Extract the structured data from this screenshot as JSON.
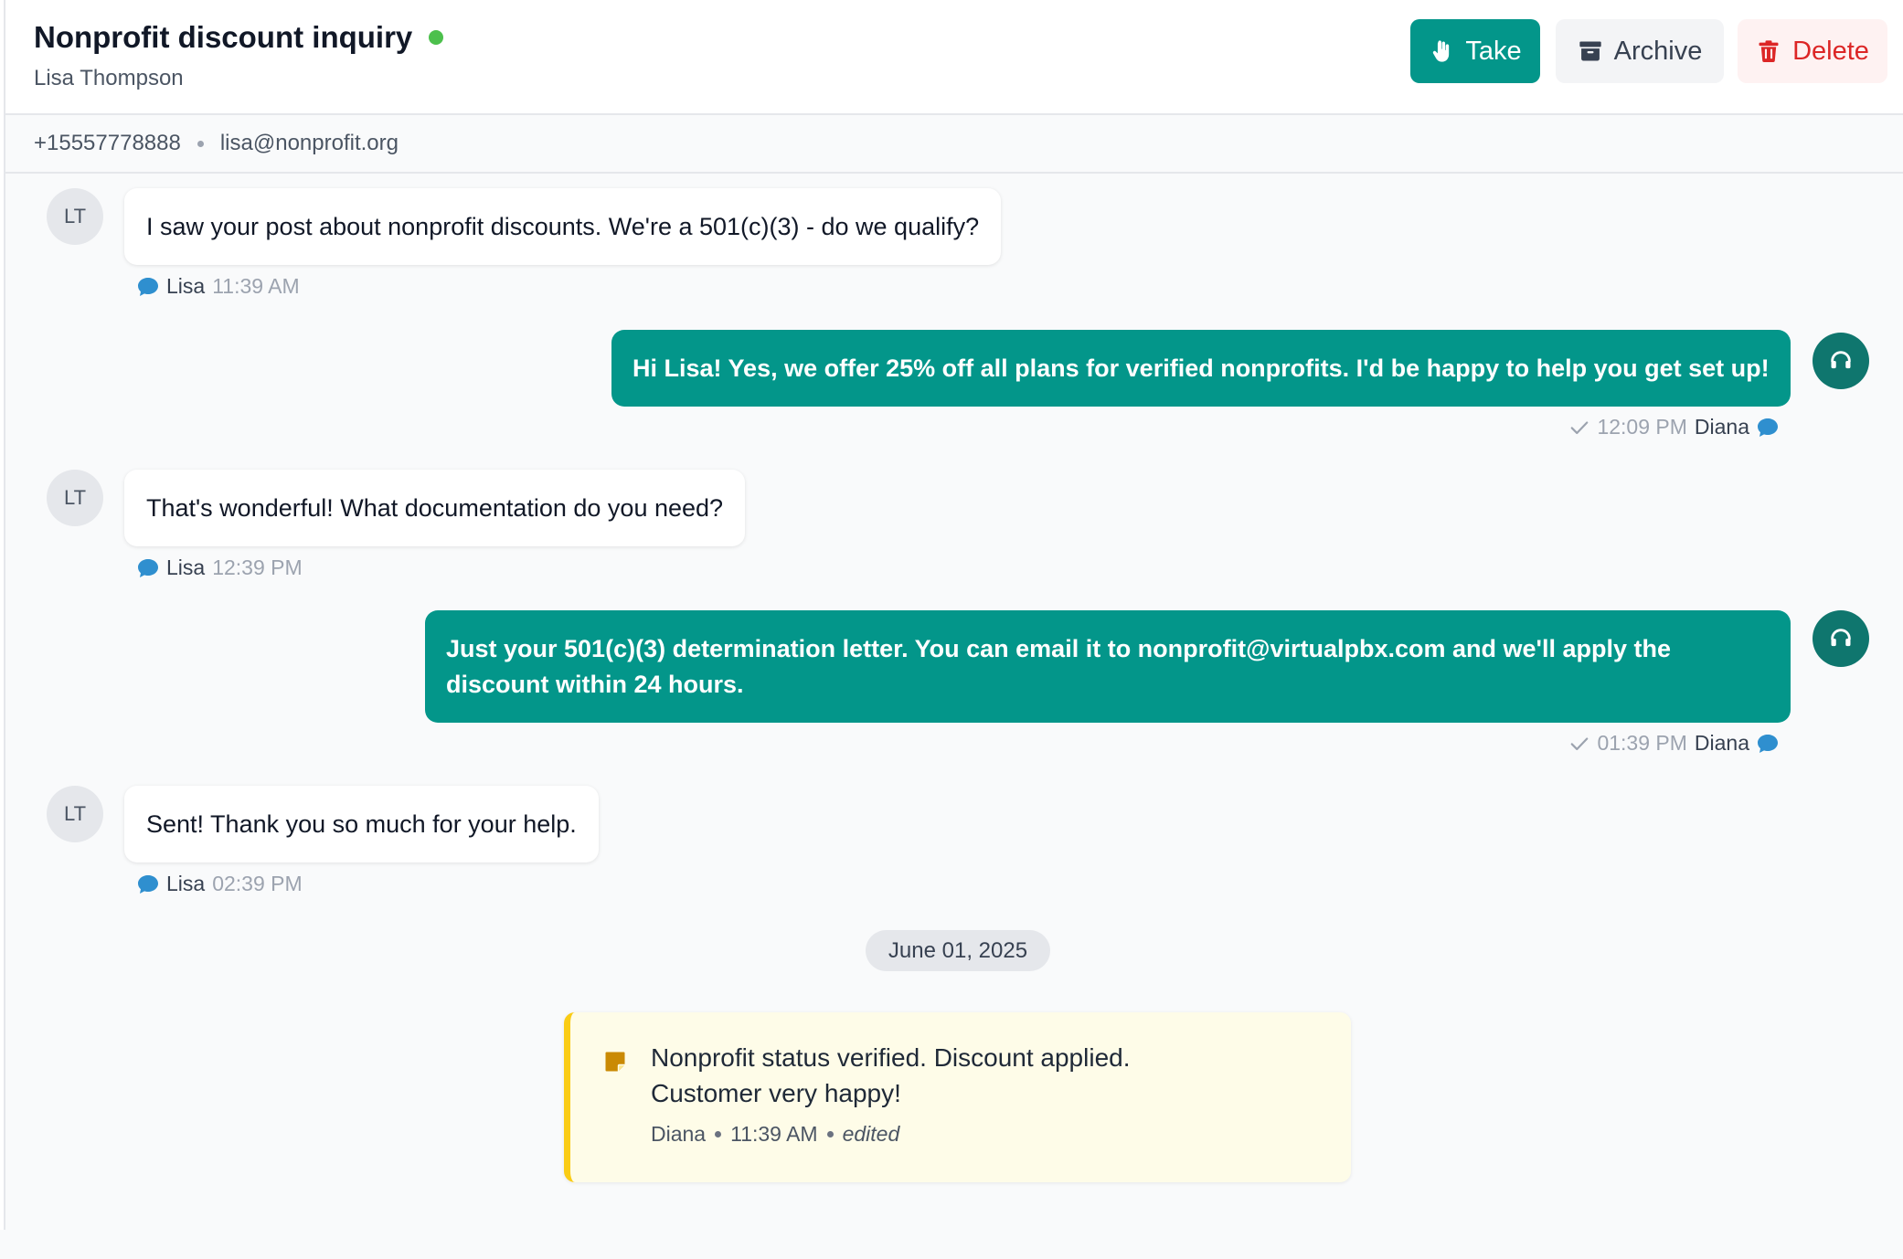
{
  "conversation": {
    "title": "Nonprofit discount inquiry",
    "contact_name": "Lisa Thompson",
    "status_color": "#4cc04c",
    "phone": "+15557778888",
    "email": "lisa@nonprofit.org"
  },
  "actions": {
    "take_label": "Take",
    "take_icon": "hand-icon",
    "archive_label": "Archive",
    "archive_icon": "archive-box-icon",
    "delete_label": "Delete",
    "delete_icon": "trash-icon"
  },
  "colors": {
    "accent": "#03968a",
    "agent_avatar": "#0f766e",
    "delete": "#dc2626",
    "note_border": "#facc15",
    "channel_icon": "#2f8fcf"
  },
  "messages": [
    {
      "direction": "in",
      "avatar": "LT",
      "text": "I saw your post about nonprofit discounts. We're a 501(c)(3) - do we qualify?",
      "sender": "Lisa",
      "time": "11:39 AM",
      "channel_icon": "chat-bubble-icon"
    },
    {
      "direction": "out",
      "avatar_icon": "headset-icon",
      "text": "Hi Lisa! Yes, we offer 25% off all plans for verified nonprofits. I'd be happy to help you get set up!",
      "sender": "Diana",
      "time": "12:09 PM",
      "status_icon": "check-icon",
      "channel_icon": "chat-bubble-icon"
    },
    {
      "direction": "in",
      "avatar": "LT",
      "text": "That's wonderful! What documentation do you need?",
      "sender": "Lisa",
      "time": "12:39 PM",
      "channel_icon": "chat-bubble-icon"
    },
    {
      "direction": "out",
      "avatar_icon": "headset-icon",
      "text_line1": "Just your 501(c)(3) determination letter. You can email it to nonprofit@virtualpbx.com and we'll apply the",
      "text_line2": "discount within 24 hours.",
      "sender": "Diana",
      "time": "01:39 PM",
      "status_icon": "check-icon",
      "channel_icon": "chat-bubble-icon"
    },
    {
      "direction": "in",
      "avatar": "LT",
      "text": "Sent! Thank you so much for your help.",
      "sender": "Lisa",
      "time": "02:39 PM",
      "channel_icon": "chat-bubble-icon"
    }
  ],
  "date_divider": "June 01, 2025",
  "note": {
    "icon": "sticky-note-icon",
    "line1": "Nonprofit status verified. Discount applied.",
    "line2": "Customer very happy!",
    "author": "Diana",
    "time": "11:39 AM",
    "edited_label": "edited"
  }
}
